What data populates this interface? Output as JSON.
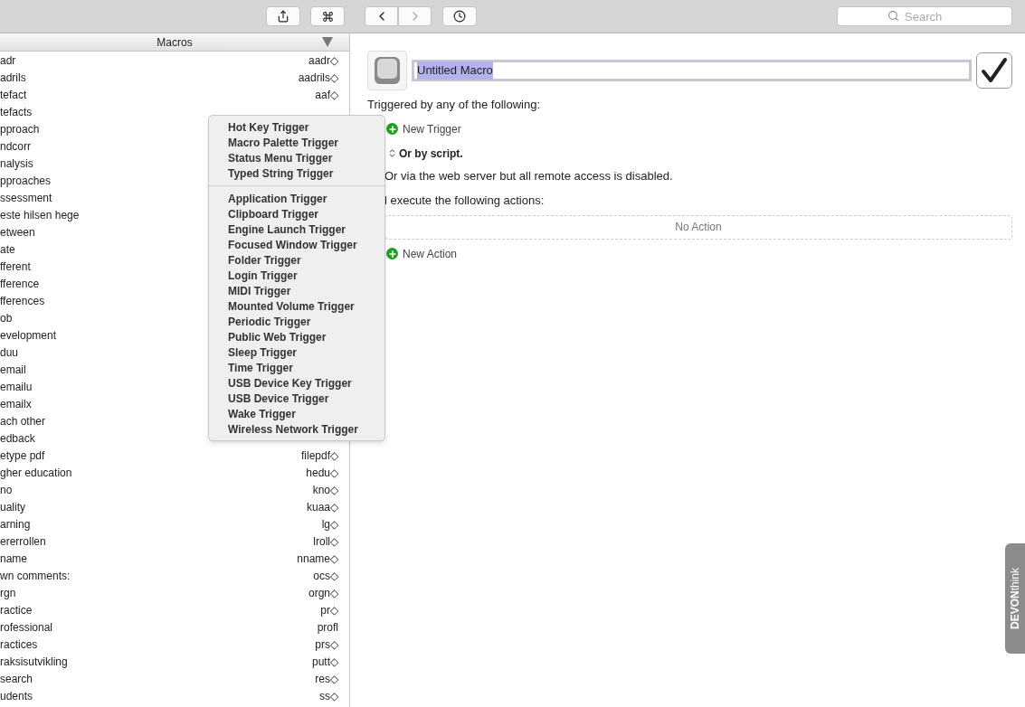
{
  "toolbar": {
    "search": {
      "placeholder": "Search"
    }
  },
  "macros": {
    "header": "Macros",
    "rows": [
      {
        "name": "adr",
        "shortcut": "aadr◇"
      },
      {
        "name": "adrils",
        "shortcut": "aadrils◇"
      },
      {
        "name": "tefact",
        "shortcut": "aaf◇"
      },
      {
        "name": "tefacts"
      },
      {
        "name": "pproach"
      },
      {
        "name": "ndcorr"
      },
      {
        "name": "nalysis"
      },
      {
        "name": "pproaches"
      },
      {
        "name": "ssessment"
      },
      {
        "name": "este hilsen hege"
      },
      {
        "name": "etween"
      },
      {
        "name": "ate"
      },
      {
        "name": "fferent"
      },
      {
        "name": "fference"
      },
      {
        "name": "fferences"
      },
      {
        "name": "ob"
      },
      {
        "name": "evelopment"
      },
      {
        "name": "duu"
      },
      {
        "name": "email"
      },
      {
        "name": "emailu"
      },
      {
        "name": "emailx"
      },
      {
        "name": "ach other"
      },
      {
        "name": "edback"
      },
      {
        "name": "etype pdf",
        "shortcut": "filepdf◇"
      },
      {
        "name": "gher education",
        "shortcut": "hedu◇"
      },
      {
        "name": "no",
        "shortcut": "kno◇"
      },
      {
        "name": "uality",
        "shortcut": "kuaa◇"
      },
      {
        "name": "arning",
        "shortcut": "lg◇"
      },
      {
        "name": "ererrollen",
        "shortcut": "lroll◇"
      },
      {
        "name": "name",
        "shortcut": "nname◇"
      },
      {
        "name": "wn comments:",
        "shortcut": "ocs◇"
      },
      {
        "name": "rgn",
        "shortcut": "orgn◇"
      },
      {
        "name": "ractice",
        "shortcut": "pr◇"
      },
      {
        "name": "rofessional",
        "shortcut": "profl"
      },
      {
        "name": "ractices",
        "shortcut": "prs◇"
      },
      {
        "name": "raksisutvikling",
        "shortcut": "putt◇"
      },
      {
        "name": "search",
        "shortcut": "res◇"
      },
      {
        "name": "udents",
        "shortcut": "ss◇"
      }
    ]
  },
  "trigger_menu": {
    "groups": [
      [
        "Hot Key Trigger",
        "Macro Palette Trigger",
        "Status Menu Trigger",
        "Typed String Trigger"
      ],
      [
        "Application Trigger",
        "Clipboard Trigger",
        "Engine Launch Trigger",
        "Focused Window Trigger",
        "Folder Trigger",
        "Login Trigger",
        "MIDI Trigger",
        "Mounted Volume Trigger",
        "Periodic Trigger",
        "Public Web Trigger",
        "Sleep Trigger",
        "Time Trigger",
        "USB Device Key Trigger",
        "USB Device Trigger",
        "Wake Trigger",
        "Wireless Network Trigger"
      ]
    ]
  },
  "editor": {
    "macro_name": "Untitled Macro",
    "enabled": true,
    "triggered_label": "Triggered by any of the following:",
    "new_trigger": "New Trigger",
    "script_label": "Or by script.",
    "web_server_note": "Or via the web server but all remote access is disabled.",
    "actions_label": "l execute the following actions:",
    "no_action": "No Action",
    "new_action": "New Action"
  },
  "side_tab": {
    "label": "**DEVON**think"
  }
}
